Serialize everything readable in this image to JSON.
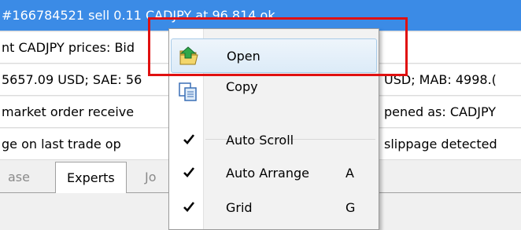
{
  "log_rows": [
    {
      "left": "#166784521 sell 0.11 CADJPY at 96.814 ok",
      "right": ""
    },
    {
      "left": "nt CADJPY prices: Bid",
      "right": ""
    },
    {
      "left": "5657.09 USD; SAE: 56",
      "right": "USD; MAB: 4998.("
    },
    {
      "left": "market order receive",
      "right": "pened as: CADJPY"
    },
    {
      "left": "ge on last trade op",
      "right": "slippage detected"
    }
  ],
  "tabs": [
    {
      "label": "ase"
    },
    {
      "label": "Experts"
    },
    {
      "label": "Jo"
    }
  ],
  "context_menu": {
    "items": [
      {
        "label": "Open",
        "shortcut": "",
        "icon": "folder-open-icon"
      },
      {
        "label": "Copy",
        "shortcut": "",
        "icon": "copy-icon"
      },
      {
        "label": "Auto Scroll",
        "shortcut": "",
        "checked": true
      },
      {
        "label": "Auto Arrange",
        "shortcut": "A",
        "checked": true
      },
      {
        "label": "Grid",
        "shortcut": "G",
        "checked": true
      }
    ]
  },
  "colors": {
    "selection": "#3b8be6",
    "highlight_border": "#e01010"
  }
}
